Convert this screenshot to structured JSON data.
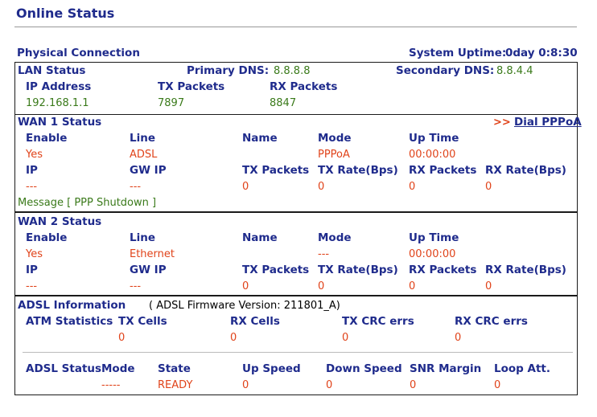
{
  "page": {
    "title": "Online Status"
  },
  "physical": {
    "title": "Physical Connection",
    "uptime_label": "System Uptime:",
    "uptime_value": "0day 0:8:30"
  },
  "lan": {
    "title": "LAN Status",
    "primary_dns_label": "Primary DNS:",
    "primary_dns": "8.8.8.8",
    "secondary_dns_label": "Secondary DNS:",
    "secondary_dns": "8.8.4.4",
    "headers": [
      "IP Address",
      "TX Packets",
      "RX Packets"
    ],
    "values": [
      "192.168.1.1",
      "7897",
      "8847"
    ]
  },
  "wan1": {
    "title": "WAN 1 Status",
    "dial_arrows": ">>",
    "dial_link": "Dial PPPoA",
    "row1_headers": [
      "Enable",
      "Line",
      "Name",
      "Mode",
      "Up Time"
    ],
    "row1_values": [
      "Yes",
      "ADSL",
      "",
      "PPPoA",
      "00:00:00"
    ],
    "row2_headers": [
      "IP",
      "GW IP",
      "TX Packets",
      "TX Rate(Bps)",
      "RX Packets",
      "RX Rate(Bps)"
    ],
    "row2_values": [
      "---",
      "---",
      "0",
      "0",
      "0",
      "0"
    ],
    "message": "Message [ PPP Shutdown ]"
  },
  "wan2": {
    "title": "WAN 2 Status",
    "row1_headers": [
      "Enable",
      "Line",
      "Name",
      "Mode",
      "Up Time"
    ],
    "row1_values": [
      "Yes",
      "Ethernet",
      "",
      "---",
      "00:00:00"
    ],
    "row2_headers": [
      "IP",
      "GW IP",
      "TX Packets",
      "TX Rate(Bps)",
      "RX Packets",
      "RX Rate(Bps)"
    ],
    "row2_values": [
      "---",
      "---",
      "0",
      "0",
      "0",
      "0"
    ]
  },
  "adsl": {
    "title": "ADSL Information",
    "firmware": "( ADSL Firmware Version:  211801_A)",
    "atm_label": "ATM Statistics",
    "atm_headers": [
      "TX Cells",
      "RX Cells",
      "TX CRC errs",
      "RX CRC errs"
    ],
    "atm_values": [
      "0",
      "0",
      "0",
      "0"
    ],
    "status_label": "ADSL Status",
    "status_headers": [
      "Mode",
      "State",
      "Up Speed",
      "Down Speed",
      "SNR Margin",
      "Loop Att."
    ],
    "status_values": [
      "-----",
      "READY",
      "0",
      "0",
      "0",
      "0"
    ]
  }
}
